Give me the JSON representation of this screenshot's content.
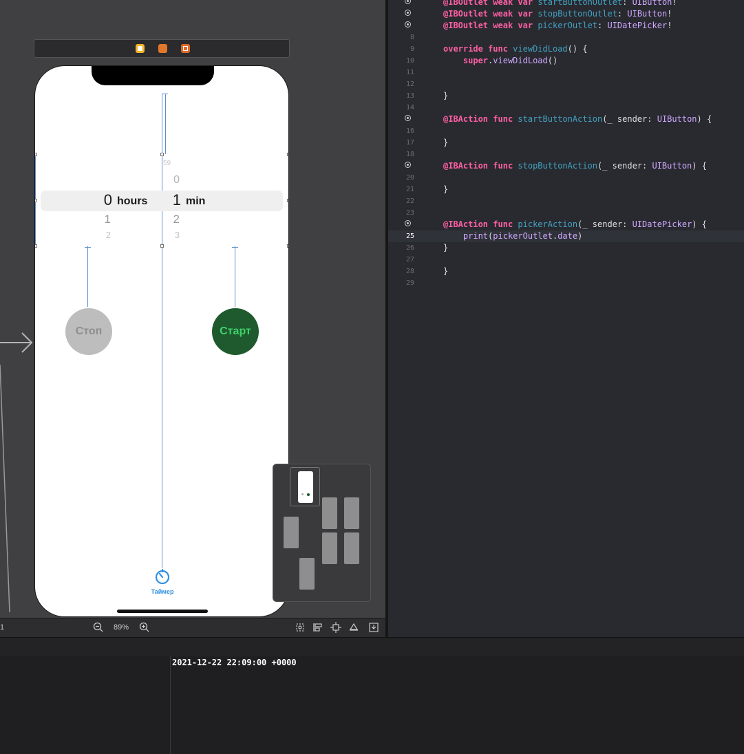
{
  "canvas": {
    "picker": {
      "hours_col": {
        "above2": "",
        "above1": "",
        "selected": "0",
        "unit": "hours",
        "below1": "1",
        "below2": "2"
      },
      "min_col": {
        "above2": "59",
        "above1": "0",
        "selected": "1",
        "unit": "min",
        "below1": "2",
        "below2": "3"
      }
    },
    "stop_label": "Стоп",
    "start_label": "Старт",
    "tab_label": "Таймер",
    "zoom": "89%",
    "toolbar_left": "1",
    "colors": {
      "start_bg": "#1e5a2d",
      "start_text": "#3ed26a",
      "stop_bg": "#bdbdbd",
      "accent": "#2f8fe0"
    }
  },
  "editor": {
    "lines": [
      {
        "n": "",
        "ib": true,
        "parts": [
          [
            "kw",
            "@IBOutlet"
          ],
          [
            "pl",
            " "
          ],
          [
            "kw",
            "weak"
          ],
          [
            "pl",
            " "
          ],
          [
            "kw",
            "var"
          ],
          [
            "pl",
            " "
          ],
          [
            "fn",
            "startButtonOutlet"
          ],
          [
            "pl",
            ": "
          ],
          [
            "ty",
            "UIButton"
          ],
          [
            "pl",
            "!"
          ]
        ]
      },
      {
        "n": "",
        "ib": true,
        "parts": [
          [
            "kw",
            "@IBOutlet"
          ],
          [
            "pl",
            " "
          ],
          [
            "kw",
            "weak"
          ],
          [
            "pl",
            " "
          ],
          [
            "kw",
            "var"
          ],
          [
            "pl",
            " "
          ],
          [
            "fn",
            "stopButtonOutlet"
          ],
          [
            "pl",
            ": "
          ],
          [
            "ty",
            "UIButton"
          ],
          [
            "pl",
            "!"
          ]
        ]
      },
      {
        "n": "",
        "ib": true,
        "parts": [
          [
            "kw",
            "@IBOutlet"
          ],
          [
            "pl",
            " "
          ],
          [
            "kw",
            "weak"
          ],
          [
            "pl",
            " "
          ],
          [
            "kw",
            "var"
          ],
          [
            "pl",
            " "
          ],
          [
            "fn",
            "pickerOutlet"
          ],
          [
            "pl",
            ": "
          ],
          [
            "ty",
            "UIDatePicker"
          ],
          [
            "pl",
            "!"
          ]
        ]
      },
      {
        "n": "8",
        "ib": false,
        "parts": []
      },
      {
        "n": "9",
        "ib": false,
        "parts": [
          [
            "kw",
            "override"
          ],
          [
            "pl",
            " "
          ],
          [
            "kw",
            "func"
          ],
          [
            "pl",
            " "
          ],
          [
            "fn",
            "viewDidLoad"
          ],
          [
            "pl",
            "() {"
          ]
        ]
      },
      {
        "n": "10",
        "ib": false,
        "parts": [
          [
            "pl",
            "    "
          ],
          [
            "kw",
            "super"
          ],
          [
            "pl",
            "."
          ],
          [
            "ty",
            "viewDidLoad"
          ],
          [
            "pl",
            "()"
          ]
        ]
      },
      {
        "n": "11",
        "ib": false,
        "parts": []
      },
      {
        "n": "12",
        "ib": false,
        "parts": []
      },
      {
        "n": "13",
        "ib": false,
        "parts": [
          [
            "pl",
            "}"
          ]
        ]
      },
      {
        "n": "14",
        "ib": false,
        "parts": []
      },
      {
        "n": "",
        "ib": true,
        "parts": [
          [
            "kw",
            "@IBAction"
          ],
          [
            "pl",
            " "
          ],
          [
            "kw",
            "func"
          ],
          [
            "pl",
            " "
          ],
          [
            "fn",
            "startButtonAction"
          ],
          [
            "pl",
            "(_ sender: "
          ],
          [
            "ty",
            "UIButton"
          ],
          [
            "pl",
            ") {"
          ]
        ]
      },
      {
        "n": "16",
        "ib": false,
        "parts": []
      },
      {
        "n": "17",
        "ib": false,
        "parts": [
          [
            "pl",
            "}"
          ]
        ]
      },
      {
        "n": "18",
        "ib": false,
        "parts": []
      },
      {
        "n": "",
        "ib": true,
        "parts": [
          [
            "kw",
            "@IBAction"
          ],
          [
            "pl",
            " "
          ],
          [
            "kw",
            "func"
          ],
          [
            "pl",
            " "
          ],
          [
            "fn",
            "stopButtonAction"
          ],
          [
            "pl",
            "(_ sender: "
          ],
          [
            "ty",
            "UIButton"
          ],
          [
            "pl",
            ") {"
          ]
        ]
      },
      {
        "n": "20",
        "ib": false,
        "parts": []
      },
      {
        "n": "21",
        "ib": false,
        "parts": [
          [
            "pl",
            "}"
          ]
        ]
      },
      {
        "n": "22",
        "ib": false,
        "parts": []
      },
      {
        "n": "23",
        "ib": false,
        "parts": []
      },
      {
        "n": "",
        "ib": true,
        "parts": [
          [
            "kw",
            "@IBAction"
          ],
          [
            "pl",
            " "
          ],
          [
            "kw",
            "func"
          ],
          [
            "pl",
            " "
          ],
          [
            "fn",
            "pickerAction"
          ],
          [
            "pl",
            "(_ sender: "
          ],
          [
            "ty",
            "UIDatePicker"
          ],
          [
            "pl",
            ") {"
          ]
        ]
      },
      {
        "n": "25",
        "ib": false,
        "current": true,
        "parts": [
          [
            "pl",
            "    "
          ],
          [
            "ty",
            "print"
          ],
          [
            "pl",
            "("
          ],
          [
            "ty",
            "pickerOutlet"
          ],
          [
            "pl",
            "."
          ],
          [
            "ty",
            "date"
          ],
          [
            "pl",
            ")"
          ]
        ]
      },
      {
        "n": "26",
        "ib": false,
        "parts": [
          [
            "pl",
            "}"
          ]
        ]
      },
      {
        "n": "27",
        "ib": false,
        "parts": []
      },
      {
        "n": "28",
        "ib": false,
        "parts": [
          [
            "pl",
            "}"
          ]
        ]
      },
      {
        "n": "29",
        "ib": false,
        "parts": []
      }
    ]
  },
  "console": {
    "output": "2021-12-22 22:09:00 +0000"
  }
}
